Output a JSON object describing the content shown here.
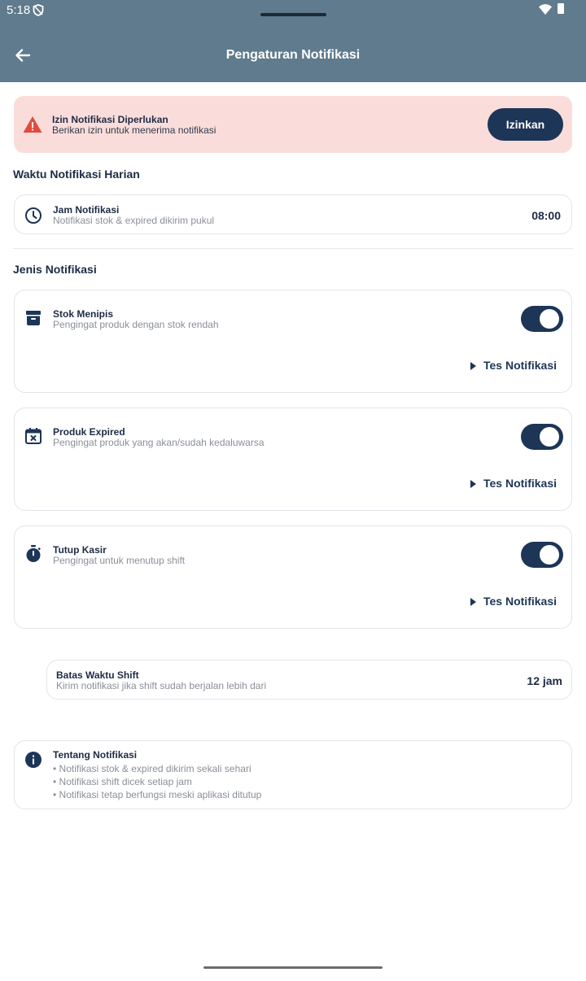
{
  "status_bar": {
    "time": "5:18"
  },
  "app_bar": {
    "title": "Pengaturan Notifikasi"
  },
  "permission_alert": {
    "title": "Izin Notifikasi Diperlukan",
    "subtitle": "Berikan izin untuk menerima notifikasi",
    "button_label": "Izinkan"
  },
  "daily_section": {
    "title": "Waktu Notifikasi Harian",
    "time_row": {
      "title": "Jam Notifikasi",
      "subtitle": "Notifikasi stok & expired dikirim pukul",
      "value": "08:00"
    }
  },
  "types_section": {
    "title": "Jenis Notifikasi",
    "items": [
      {
        "title": "Stok Menipis",
        "subtitle": "Pengingat produk dengan stok rendah",
        "enabled": true,
        "test_label": "Tes Notifikasi",
        "icon": "archive-box-icon"
      },
      {
        "title": "Produk Expired",
        "subtitle": "Pengingat produk yang akan/sudah kedaluwarsa",
        "enabled": true,
        "test_label": "Tes Notifikasi",
        "icon": "calendar-x-icon"
      },
      {
        "title": "Tutup Kasir",
        "subtitle": "Pengingat untuk menutup shift",
        "enabled": true,
        "test_label": "Tes Notifikasi",
        "icon": "stopwatch-icon"
      }
    ]
  },
  "shift_limit": {
    "title": "Batas Waktu Shift",
    "subtitle": "Kirim notifikasi jika shift sudah berjalan lebih dari",
    "value": "12 jam"
  },
  "about": {
    "title": "Tentang Notifikasi",
    "lines": [
      "• Notifikasi stok & expired dikirim sekali sehari",
      "• Notifikasi shift dicek setiap jam",
      "• Notifikasi tetap berfungsi meski aplikasi ditutup"
    ]
  },
  "colors": {
    "app_bar": "#5f7b8d",
    "primary": "#1d3557",
    "alert_bg": "#fadddb",
    "alert_icon": "#e04b3f"
  }
}
